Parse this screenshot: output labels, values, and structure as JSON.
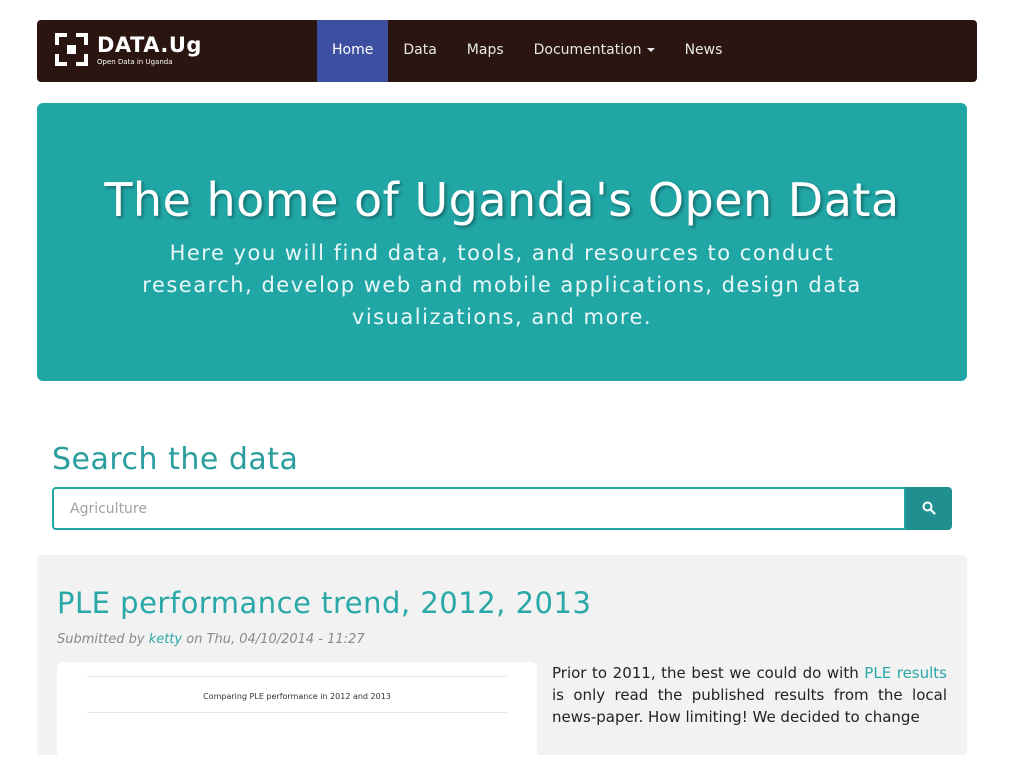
{
  "brand": {
    "name": "DATA.Ug",
    "tagline": "Open Data in Uganda"
  },
  "nav": {
    "items": [
      {
        "label": "Home",
        "active": true
      },
      {
        "label": "Data",
        "active": false
      },
      {
        "label": "Maps",
        "active": false
      },
      {
        "label": "Documentation",
        "active": false,
        "dropdown": true
      },
      {
        "label": "News",
        "active": false
      }
    ]
  },
  "hero": {
    "title": "The home of Uganda's Open Data",
    "subtitle": "Here you will find data, tools, and resources to conduct research, develop web and mobile applications, design data visualizations, and more."
  },
  "search": {
    "heading": "Search the data",
    "placeholder": "Agriculture",
    "button_icon": "search-icon"
  },
  "article": {
    "title": "PLE performance trend, 2012, 2013",
    "meta_prefix": "Submitted by ",
    "author": "ketty",
    "meta_suffix": " on Thu, 04/10/2014 - 11:27",
    "thumbnail_caption": "Comparing PLE performance in 2012 and 2013",
    "body_before_link": "Prior to 2011, the best we could do with ",
    "body_link": "PLE results",
    "body_after_link": " is only read the published results from the local news-paper. How limiting! We decided to change"
  },
  "colors": {
    "navbar_bg": "#2a1510",
    "nav_active_bg": "#3d4fa0",
    "accent": "#21a6a6",
    "search_button": "#1f8f8f",
    "article_bg": "#f2f2f2"
  }
}
